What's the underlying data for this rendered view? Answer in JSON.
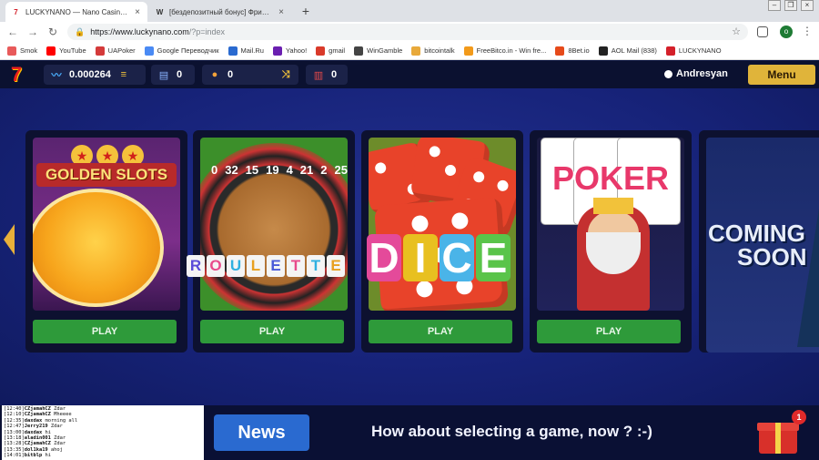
{
  "browser": {
    "tabs": [
      {
        "title": "LUCKYNANO — Nano Casino & Nano",
        "active": true
      },
      {
        "title": "[бездепозитный бонус] Фриспины",
        "active": false
      }
    ],
    "new_tab_label": "+",
    "url_host": "https://www.luckynano.com",
    "url_path": "/?p=index",
    "profile_initial": "o",
    "bookmarks": [
      {
        "label": "Smok",
        "color": "#e85a5a"
      },
      {
        "label": "YouTube",
        "color": "#ff0000"
      },
      {
        "label": "UAPoker",
        "color": "#d43a3a"
      },
      {
        "label": "Google Переводчик",
        "color": "#4a8af4"
      },
      {
        "label": "Mail.Ru",
        "color": "#2a6ad0"
      },
      {
        "label": "Yahoo!",
        "color": "#6a1fb0"
      },
      {
        "label": "gmail",
        "color": "#d93a2a"
      },
      {
        "label": "WinGamble",
        "color": "#444444"
      },
      {
        "label": "bitcointalk",
        "color": "#e8a93a"
      },
      {
        "label": "FreeBitco.in - Win fre...",
        "color": "#f29a1a"
      },
      {
        "label": "8Bet.io",
        "color": "#e64a1a"
      },
      {
        "label": "AOL Mail (838)",
        "color": "#222222"
      },
      {
        "label": "LUCKYNANO",
        "color": "#d4202a"
      }
    ]
  },
  "header": {
    "logo_text": "7",
    "balance": "0.000264",
    "tickets": "0",
    "coins": "0",
    "cards": "0",
    "username": "Andresyan",
    "menu_label": "Menu"
  },
  "games": [
    {
      "name": "Golden Slots",
      "art_text": "GOLDEN SLOTS",
      "play_label": "PLAY"
    },
    {
      "name": "Roulette",
      "art_text": "ROULETTE",
      "play_label": "PLAY"
    },
    {
      "name": "Dice",
      "art_text": "DICE",
      "play_label": "PLAY"
    },
    {
      "name": "Poker",
      "art_text": "POKER",
      "play_label": "PLAY"
    }
  ],
  "roulette_numbers": [
    "0",
    "32",
    "15",
    "19",
    "4",
    "21",
    "2",
    "25"
  ],
  "roulette_letters": [
    "R",
    "O",
    "U",
    "L",
    "E",
    "T",
    "T",
    "E"
  ],
  "roulette_letter_colors": [
    "#5a4bd8",
    "#e84a8a",
    "#30b0e0",
    "#e8a020",
    "#4a5ad8",
    "#e84a8a",
    "#30b0e0",
    "#e8a020"
  ],
  "dice_letters": [
    "D",
    "I",
    "C",
    "E"
  ],
  "dice_letter_colors": [
    "#e44a9a",
    "#e8c020",
    "#4ab4e8",
    "#5ac44a"
  ],
  "coming_soon": {
    "line1": "COMING",
    "line2": "SOON"
  },
  "chat": [
    {
      "time": "[12:40]",
      "user": "CZjamahCZ",
      "msg": "Zdar"
    },
    {
      "time": "[12:10]",
      "user": "CZjamahCZ",
      "msg": "Mheeee"
    },
    {
      "time": "[12:35]",
      "user": "daxdax",
      "msg": "morning all"
    },
    {
      "time": "[12:47]",
      "user": "Jerry219",
      "msg": "Zdar"
    },
    {
      "time": "[13:00]",
      "user": "daxdax",
      "msg": "hi"
    },
    {
      "time": "[13:18]",
      "user": "aladin001",
      "msg": "Zdar"
    },
    {
      "time": "[13:28]",
      "user": "CZjamahCZ",
      "msg": "Zdar"
    },
    {
      "time": "[13:35]",
      "user": "dol1ka19",
      "msg": "ahoj"
    },
    {
      "time": "[14:01]",
      "user": "bitblp",
      "msg": "hi"
    }
  ],
  "news_label": "News",
  "ticker_text": "How about selecting a game, now ? :-)",
  "gift_badge": "1",
  "colors": {
    "accent_gold": "#e0b43a",
    "play_green": "#2e9a3a",
    "news_blue": "#2a6ad0",
    "stage_blue": "#17237a"
  }
}
